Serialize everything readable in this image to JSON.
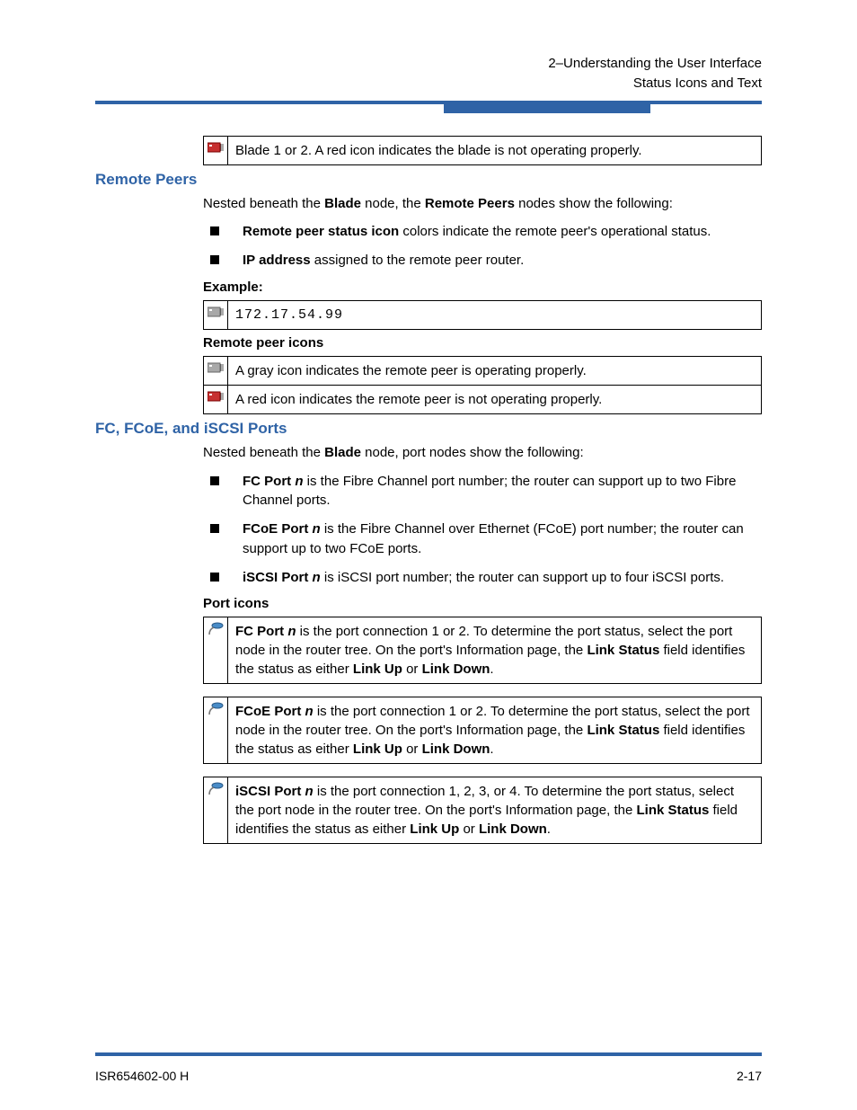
{
  "header": {
    "line1": "2–Understanding the User Interface",
    "line2": "Status Icons and Text"
  },
  "blade_box": {
    "text": "Blade 1 or 2. A red icon indicates the blade is not operating properly."
  },
  "remote_peers": {
    "heading": "Remote Peers",
    "intro_pre": "Nested beneath the ",
    "intro_b1": "Blade",
    "intro_mid": " node, the ",
    "intro_b2": "Remote Peers",
    "intro_post": " nodes show the following:",
    "bullets": [
      {
        "b": "Remote peer status icon",
        "rest": " colors indicate the remote peer's operational status."
      },
      {
        "b": "IP address",
        "rest": " assigned to the remote peer router."
      }
    ],
    "example_label": "Example",
    "example_ip": "172.17.54.99",
    "icons_label": "Remote peer icons",
    "icon_rows": [
      "A gray icon indicates the remote peer is operating properly.",
      "A red icon indicates the remote peer is not operating properly."
    ]
  },
  "ports": {
    "heading": "FC, FCoE, and iSCSI Ports",
    "intro_pre": "Nested beneath the ",
    "intro_b": "Blade",
    "intro_post": " node, port nodes show the following:",
    "bullets": [
      {
        "b1": "FC Port ",
        "i": "n",
        "rest": " is the Fibre Channel port number; the router can support up to two Fibre Channel ports."
      },
      {
        "b1": "FCoE Port ",
        "i": "n",
        "rest": " is the Fibre Channel over Ethernet (FCoE) port number; the router can support up to two FCoE ports."
      },
      {
        "b1": "iSCSI Port ",
        "i": "n",
        "rest": " is iSCSI port number; the router can support up to four iSCSI ports."
      }
    ],
    "icons_label": "Port icons",
    "icon_rows": [
      {
        "b1": "FC Port ",
        "i": "n",
        "pre": " is the port connection 1 or 2. To determine the port status, select the port node in the router tree. On the port's Information page, the ",
        "b2": "Link Status",
        "mid": " field identifies the status as either ",
        "b3": "Link Up",
        "or": " or ",
        "b4": "Link Down",
        "end": "."
      },
      {
        "b1": "FCoE Port ",
        "i": "n",
        "pre": " is the port connection 1 or 2. To determine the port status, select the port node in the router tree. On the port's Information page, the ",
        "b2": "Link Status",
        "mid": " field identifies the status as either ",
        "b3": "Link Up",
        "or": " or ",
        "b4": "Link Down",
        "end": "."
      },
      {
        "b1": "iSCSI Port ",
        "i": "n",
        "pre": " is the port connection 1, 2, 3, or 4. To determine the port status, select the port node in the router tree. On the port's Information page, the ",
        "b2": "Link Status",
        "mid": " field identifies the status as either ",
        "b3": "Link Up",
        "or": " or ",
        "b4": "Link Down",
        "end": "."
      }
    ]
  },
  "footer": {
    "left": "ISR654602-00  H",
    "right": "2-17"
  }
}
